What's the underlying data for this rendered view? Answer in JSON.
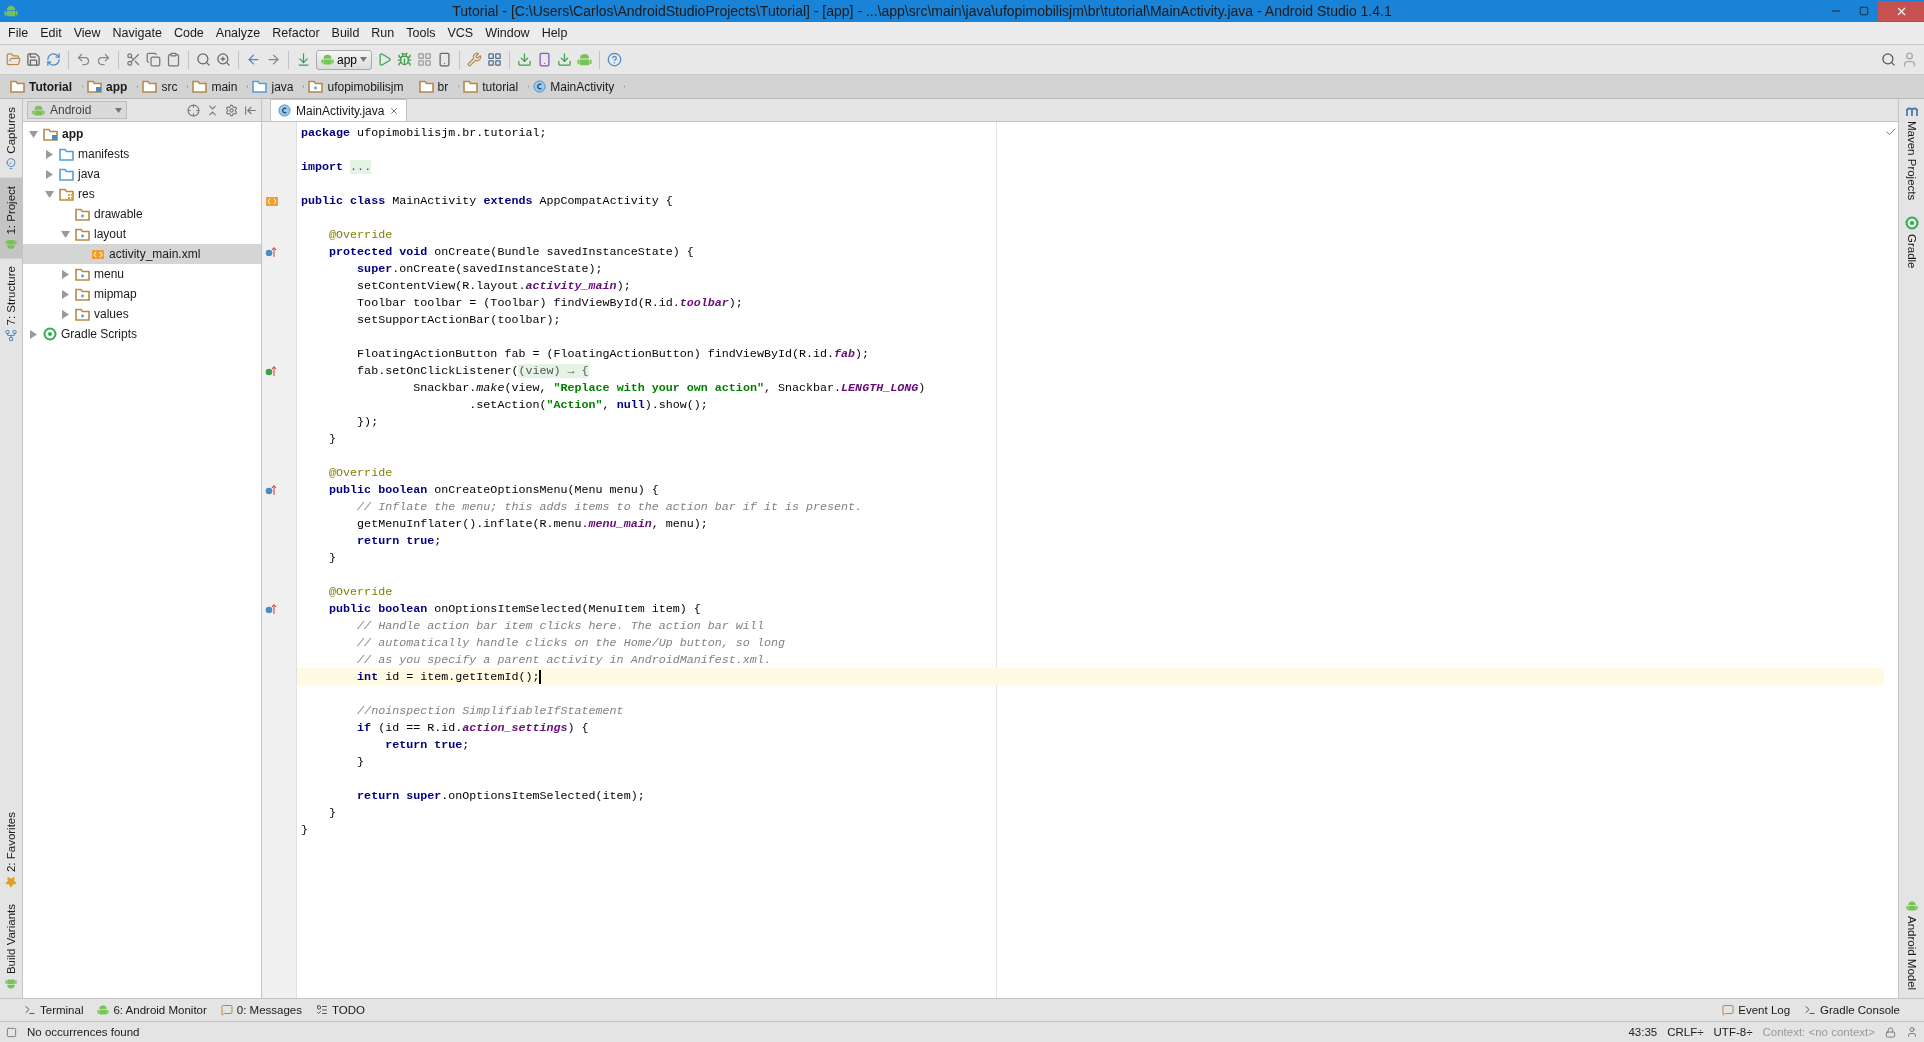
{
  "window": {
    "title": "Tutorial - [C:\\Users\\Carlos\\AndroidStudioProjects\\Tutorial] - [app] - ...\\app\\src\\main\\java\\ufopimobilisjm\\br\\tutorial\\MainActivity.java - Android Studio 1.4.1"
  },
  "menu": [
    "File",
    "Edit",
    "View",
    "Navigate",
    "Code",
    "Analyze",
    "Refactor",
    "Build",
    "Run",
    "Tools",
    "VCS",
    "Window",
    "Help"
  ],
  "toolbar": {
    "run_config": "app"
  },
  "breadcrumbs": [
    {
      "label": "Tutorial",
      "kind": "project"
    },
    {
      "label": "app",
      "kind": "module"
    },
    {
      "label": "src",
      "kind": "folder"
    },
    {
      "label": "main",
      "kind": "folder"
    },
    {
      "label": "java",
      "kind": "source"
    },
    {
      "label": "ufopimobilisjm",
      "kind": "resdir"
    },
    {
      "label": "br",
      "kind": "folder"
    },
    {
      "label": "tutorial",
      "kind": "folder"
    },
    {
      "label": "MainActivity",
      "kind": "class"
    }
  ],
  "left_stripe": {
    "top": [
      {
        "label": "Captures",
        "kind": "captures",
        "selected": false
      },
      {
        "label": "1: Project",
        "kind": "android",
        "selected": true
      },
      {
        "label": "7: Structure",
        "kind": "structure",
        "selected": false
      }
    ],
    "bottom": [
      {
        "label": "2: Favorites",
        "kind": "favorites",
        "selected": false
      },
      {
        "label": "Build Variants",
        "kind": "android",
        "selected": false
      }
    ]
  },
  "project_panel": {
    "view": "Android",
    "tree": [
      {
        "label": "app",
        "kind": "module",
        "expanded": true,
        "selected": false,
        "children": [
          {
            "label": "manifests",
            "kind": "source",
            "expanded": false,
            "selected": false
          },
          {
            "label": "java",
            "kind": "source",
            "expanded": false,
            "selected": false
          },
          {
            "label": "res",
            "kind": "res",
            "expanded": true,
            "selected": false,
            "children": [
              {
                "label": "drawable",
                "kind": "resdir",
                "selected": false
              },
              {
                "label": "layout",
                "kind": "resdir",
                "expanded": true,
                "selected": false,
                "children": [
                  {
                    "label": "activity_main.xml",
                    "kind": "xml",
                    "selected": true
                  }
                ]
              },
              {
                "label": "menu",
                "kind": "resdir",
                "expanded": false,
                "selected": false
              },
              {
                "label": "mipmap",
                "kind": "resdir",
                "expanded": false,
                "selected": false
              },
              {
                "label": "values",
                "kind": "resdir",
                "expanded": false,
                "selected": false
              }
            ]
          }
        ]
      },
      {
        "label": "Gradle Scripts",
        "kind": "gradle",
        "expanded": false,
        "selected": false
      }
    ]
  },
  "editor": {
    "tabs": [
      {
        "label": "MainActivity.java",
        "selected": true
      }
    ],
    "lines": [
      {
        "kind": "code",
        "current": false,
        "segments": [
          {
            "kind": "keyword",
            "text": "package"
          },
          {
            "kind": "plain",
            "text": " ufopimobilisjm.br.tutorial;"
          }
        ]
      },
      {
        "kind": "code",
        "current": false
      },
      {
        "kind": "code",
        "current": false,
        "segments": [
          {
            "kind": "keyword",
            "text": "import "
          },
          {
            "kind": "fold",
            "text": "..."
          }
        ]
      },
      {
        "kind": "code",
        "current": false
      },
      {
        "kind": "layout",
        "current": false,
        "segments": [
          {
            "kind": "keyword",
            "text": "public class"
          },
          {
            "kind": "plain",
            "text": " MainActivity "
          },
          {
            "kind": "keyword",
            "text": "extends"
          },
          {
            "kind": "plain",
            "text": " AppCompatActivity {"
          }
        ]
      },
      {
        "kind": "code",
        "current": false
      },
      {
        "kind": "code",
        "current": false,
        "segments": [
          {
            "kind": "annotation",
            "text": "    @Override"
          }
        ]
      },
      {
        "kind": "override",
        "current": false,
        "segments": [
          {
            "kind": "keyword",
            "text": "    protected void"
          },
          {
            "kind": "plain",
            "text": " onCreate(Bundle savedInstanceState) {"
          }
        ]
      },
      {
        "kind": "code",
        "current": false,
        "segments": [
          {
            "kind": "keyword",
            "text": "        super"
          },
          {
            "kind": "plain",
            "text": ".onCreate(savedInstanceState);"
          }
        ]
      },
      {
        "kind": "code",
        "current": false,
        "segments": [
          {
            "kind": "plain",
            "text": "        setContentView(R.layout."
          },
          {
            "kind": "field",
            "text": "activity_main"
          },
          {
            "kind": "plain",
            "text": ");"
          }
        ]
      },
      {
        "kind": "code",
        "current": false,
        "segments": [
          {
            "kind": "plain",
            "text": "        Toolbar toolbar = (Toolbar) findViewById(R.id."
          },
          {
            "kind": "field",
            "text": "toolbar"
          },
          {
            "kind": "plain",
            "text": ");"
          }
        ]
      },
      {
        "kind": "code",
        "current": false,
        "segments": [
          {
            "kind": "plain",
            "text": "        setSupportActionBar(toolbar);"
          }
        ]
      },
      {
        "kind": "code",
        "current": false
      },
      {
        "kind": "code",
        "current": false,
        "segments": [
          {
            "kind": "plain",
            "text": "        FloatingActionButton fab = (FloatingActionButton) findViewById(R.id."
          },
          {
            "kind": "field",
            "text": "fab"
          },
          {
            "kind": "plain",
            "text": ");"
          }
        ]
      },
      {
        "kind": "lambda",
        "current": false,
        "segments": [
          {
            "kind": "plain",
            "text": "        fab.setOnClickListener("
          },
          {
            "kind": "fold",
            "text": "(view) → {"
          }
        ]
      },
      {
        "kind": "code",
        "current": false,
        "segments": [
          {
            "kind": "plain",
            "text": "                Snackbar."
          },
          {
            "kind": "static",
            "text": "make"
          },
          {
            "kind": "plain",
            "text": "(view, "
          },
          {
            "kind": "string",
            "text": "\"Replace with your own action\""
          },
          {
            "kind": "plain",
            "text": ", Snackbar."
          },
          {
            "kind": "field",
            "text": "LENGTH_LONG"
          },
          {
            "kind": "plain",
            "text": ")"
          }
        ]
      },
      {
        "kind": "code",
        "current": false,
        "segments": [
          {
            "kind": "plain",
            "text": "                        .setAction("
          },
          {
            "kind": "string",
            "text": "\"Action\""
          },
          {
            "kind": "plain",
            "text": ", "
          },
          {
            "kind": "keyword",
            "text": "null"
          },
          {
            "kind": "plain",
            "text": ").show();"
          }
        ]
      },
      {
        "kind": "code",
        "current": false,
        "segments": [
          {
            "kind": "plain",
            "text": "        });"
          }
        ]
      },
      {
        "kind": "code",
        "current": false,
        "segments": [
          {
            "kind": "plain",
            "text": "    }"
          }
        ]
      },
      {
        "kind": "code",
        "current": false
      },
      {
        "kind": "code",
        "current": false,
        "segments": [
          {
            "kind": "annotation",
            "text": "    @Override"
          }
        ]
      },
      {
        "kind": "override",
        "current": false,
        "segments": [
          {
            "kind": "keyword",
            "text": "    public boolean"
          },
          {
            "kind": "plain",
            "text": " onCreateOptionsMenu(Menu menu) {"
          }
        ]
      },
      {
        "kind": "code",
        "current": false,
        "segments": [
          {
            "kind": "comment",
            "text": "        // Inflate the menu; this adds items to the action bar if it is present."
          }
        ]
      },
      {
        "kind": "code",
        "current": false,
        "segments": [
          {
            "kind": "plain",
            "text": "        getMenuInflater().inflate(R.menu."
          },
          {
            "kind": "field",
            "text": "menu_main"
          },
          {
            "kind": "plain",
            "text": ", menu);"
          }
        ]
      },
      {
        "kind": "code",
        "current": false,
        "segments": [
          {
            "kind": "keyword",
            "text": "        return true"
          },
          {
            "kind": "plain",
            "text": ";"
          }
        ]
      },
      {
        "kind": "code",
        "current": false,
        "segments": [
          {
            "kind": "plain",
            "text": "    }"
          }
        ]
      },
      {
        "kind": "code",
        "current": false
      },
      {
        "kind": "code",
        "current": false,
        "segments": [
          {
            "kind": "annotation",
            "text": "    @Override"
          }
        ]
      },
      {
        "kind": "override",
        "current": false,
        "segments": [
          {
            "kind": "keyword",
            "text": "    public boolean"
          },
          {
            "kind": "plain",
            "text": " onOptionsItemSelected(MenuItem item) {"
          }
        ]
      },
      {
        "kind": "code",
        "current": false,
        "segments": [
          {
            "kind": "comment",
            "text": "        // Handle action bar item clicks here. The action bar will"
          }
        ]
      },
      {
        "kind": "code",
        "current": false,
        "segments": [
          {
            "kind": "comment",
            "text": "        // automatically handle clicks on the Home/Up button, so long"
          }
        ]
      },
      {
        "kind": "code",
        "current": false,
        "segments": [
          {
            "kind": "comment",
            "text": "        // as you specify a parent activity in AndroidManifest.xml."
          }
        ]
      },
      {
        "kind": "code",
        "current": true,
        "segments": [
          {
            "kind": "keyword",
            "text": "        int"
          },
          {
            "kind": "plain",
            "text": " id = item.getItemId();"
          }
        ]
      },
      {
        "kind": "code",
        "current": false
      },
      {
        "kind": "code",
        "current": false,
        "segments": [
          {
            "kind": "comment",
            "text": "        //noinspection SimplifiableIfStatement"
          }
        ]
      },
      {
        "kind": "code",
        "current": false,
        "segments": [
          {
            "kind": "keyword",
            "text": "        if"
          },
          {
            "kind": "plain",
            "text": " (id == R.id."
          },
          {
            "kind": "field",
            "text": "action_settings"
          },
          {
            "kind": "plain",
            "text": ") {"
          }
        ]
      },
      {
        "kind": "code",
        "current": false,
        "segments": [
          {
            "kind": "keyword",
            "text": "            return true"
          },
          {
            "kind": "plain",
            "text": ";"
          }
        ]
      },
      {
        "kind": "code",
        "current": false,
        "segments": [
          {
            "kind": "plain",
            "text": "        }"
          }
        ]
      },
      {
        "kind": "code",
        "current": false
      },
      {
        "kind": "code",
        "current": false,
        "segments": [
          {
            "kind": "keyword",
            "text": "        return super"
          },
          {
            "kind": "plain",
            "text": ".onOptionsItemSelected(item);"
          }
        ]
      },
      {
        "kind": "code",
        "current": false,
        "segments": [
          {
            "kind": "plain",
            "text": "    }"
          }
        ]
      },
      {
        "kind": "code",
        "current": false,
        "segments": [
          {
            "kind": "plain",
            "text": "}"
          }
        ]
      }
    ]
  },
  "right_stripe": {
    "top": [
      {
        "label": "Maven Projects",
        "kind": "maven"
      },
      {
        "label": "Gradle",
        "kind": "gradle"
      }
    ],
    "bottom": [
      {
        "label": "Android Model",
        "kind": "android"
      }
    ]
  },
  "tool_windows": {
    "left": [
      {
        "label": "Terminal",
        "kind": "terminal"
      },
      {
        "label": "6: Android Monitor",
        "kind": "android"
      },
      {
        "label": "0: Messages",
        "kind": "messages"
      },
      {
        "label": "TODO",
        "kind": "todo"
      }
    ],
    "right": [
      {
        "label": "Event Log",
        "kind": "messages"
      },
      {
        "label": "Gradle Console",
        "kind": "terminal"
      }
    ]
  },
  "status_bar": {
    "message": "No occurrences found",
    "position": "43:35",
    "line_separator": "CRLF÷",
    "encoding": "UTF-8÷",
    "context": "Context: <no context>"
  }
}
